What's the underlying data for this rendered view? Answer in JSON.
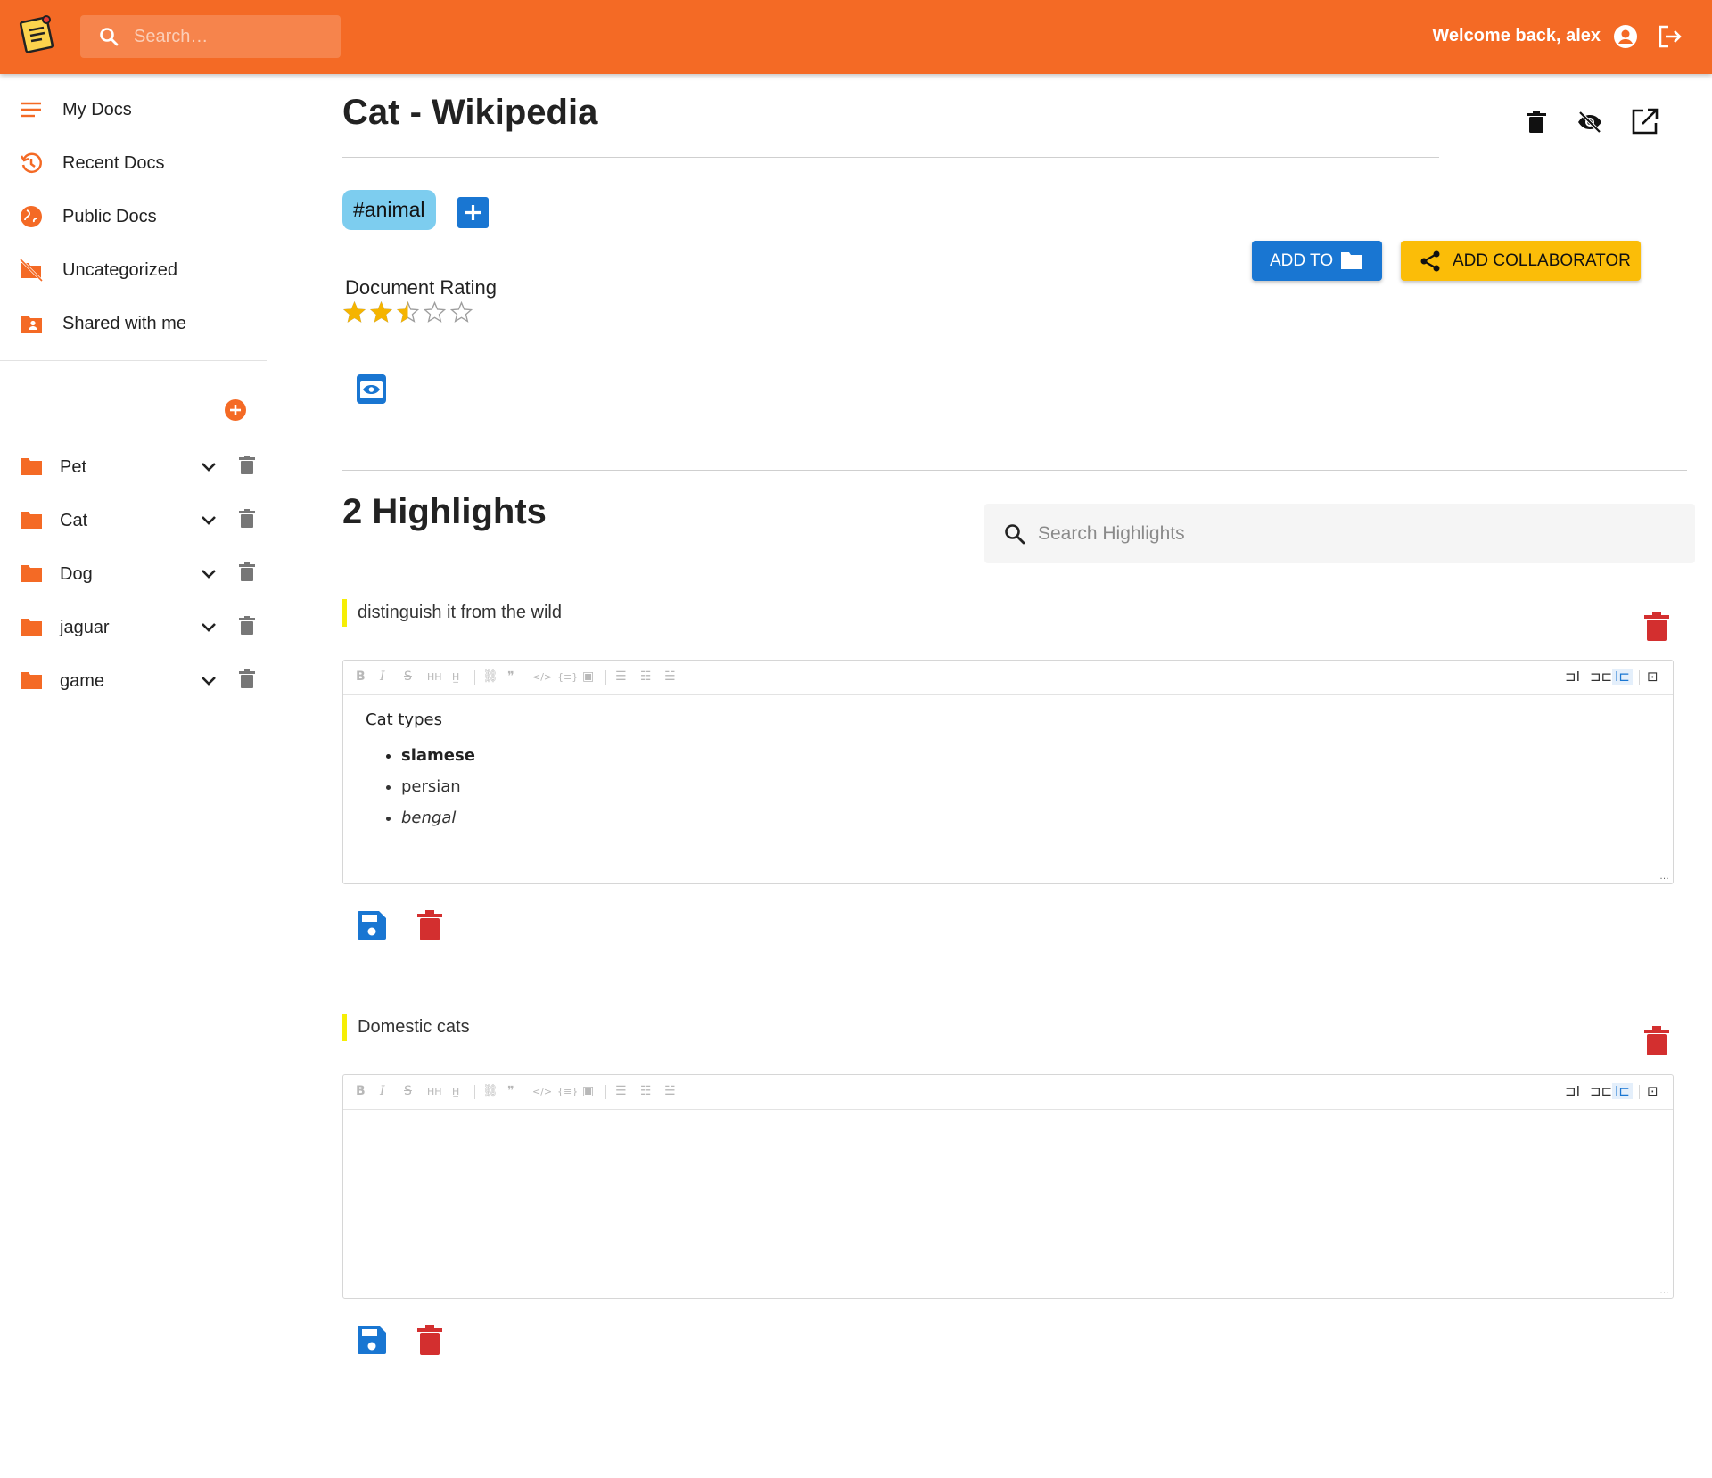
{
  "appbar": {
    "search_placeholder": "Search…",
    "welcome": "Welcome back, alex",
    "icons": [
      "notes-logo-icon",
      "search-icon",
      "account-circle-icon",
      "logout-icon"
    ],
    "color": "#f46a25"
  },
  "sidebar": {
    "nav": [
      {
        "label": "My Docs",
        "icon": "menu-lines-icon"
      },
      {
        "label": "Recent Docs",
        "icon": "history-icon"
      },
      {
        "label": "Public Docs",
        "icon": "globe-icon"
      },
      {
        "label": "Uncategorized",
        "icon": "folder-off-icon"
      },
      {
        "label": "Shared with me",
        "icon": "folder-shared-icon"
      }
    ],
    "folders": [
      {
        "label": "Pet"
      },
      {
        "label": "Cat"
      },
      {
        "label": "Dog"
      },
      {
        "label": "jaguar"
      },
      {
        "label": "game"
      }
    ]
  },
  "document": {
    "title": "Cat - Wikipedia",
    "tags": [
      "#animal"
    ],
    "rating_label": "Document Rating",
    "rating": 2.5,
    "rating_max": 5,
    "add_to_label": "ADD TO",
    "add_collaborator_label": "ADD COLLABORATOR"
  },
  "highlights": {
    "count_label": "2 Highlights",
    "search_placeholder": "Search Highlights",
    "items": [
      {
        "quote": "distinguish it from the wild",
        "note_heading": "Cat types",
        "note_items": [
          "siamese",
          "persian",
          "bengal"
        ]
      },
      {
        "quote": "Domestic cats",
        "note_heading": "",
        "note_items": []
      }
    ]
  },
  "editor_toolbar": {
    "left": [
      "B",
      "I",
      "S",
      "H",
      "H",
      "🔗",
      "❞",
      "</>",
      "{}",
      "▣",
      "≡",
      "≡",
      "≡"
    ],
    "right": [
      "side-by-side-icon",
      "preview-icon",
      "edit-icon",
      "fullscreen-icon"
    ]
  }
}
